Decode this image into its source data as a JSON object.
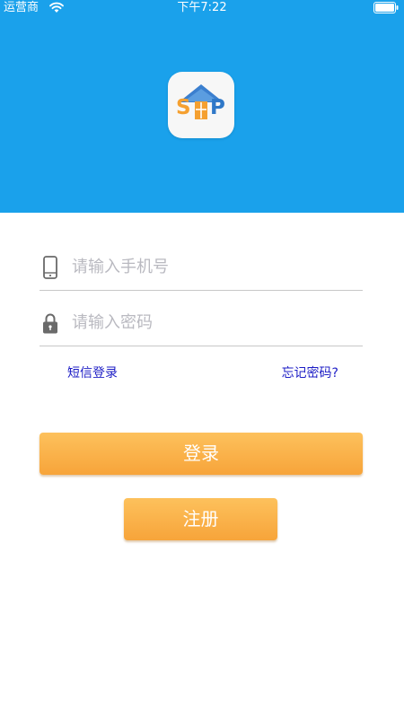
{
  "status_bar": {
    "carrier": "运营商",
    "time": "下午7:22",
    "wifi_icon": "wifi-icon",
    "battery_icon": "battery-icon"
  },
  "app_logo": {
    "letters": [
      "S",
      "O",
      "P"
    ],
    "icon_name": "house-logo-icon"
  },
  "form": {
    "phone": {
      "placeholder": "请输入手机号",
      "value": "",
      "icon": "phone-icon"
    },
    "password": {
      "placeholder": "请输入密码",
      "value": "",
      "icon": "lock-icon"
    }
  },
  "links": {
    "sms_login": "短信登录",
    "forgot_password": "忘记密码?"
  },
  "buttons": {
    "login": "登录",
    "register": "注册"
  },
  "colors": {
    "header_blue": "#1aa1eb",
    "button_orange": "#f7a43a",
    "link_blue": "#1c1cc5",
    "logo_orange": "#f5a030",
    "logo_blue": "#2f78c8"
  }
}
